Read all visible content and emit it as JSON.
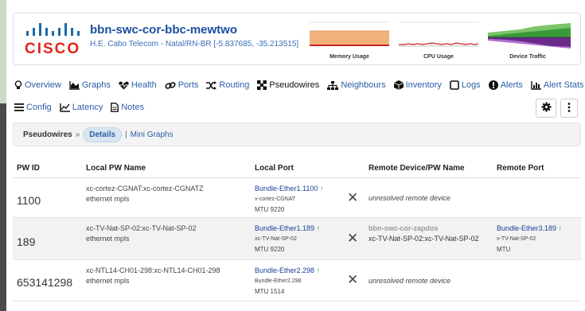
{
  "device": {
    "logo_text": "CISCO",
    "hostname": "bbn-swc-cor-bbc-mewtwo",
    "location": "H.E. Cabo Telecom - Natal/RN-BR [-5.837685, -35.213515]"
  },
  "graphs": [
    {
      "caption": "Memory Usage"
    },
    {
      "caption": "CPU Usage"
    },
    {
      "caption": "Device Traffic"
    }
  ],
  "nav": {
    "row1": [
      {
        "label": "Overview",
        "icon": "lightbulb-icon"
      },
      {
        "label": "Graphs",
        "icon": "area-chart-icon"
      },
      {
        "label": "Health",
        "icon": "heartbeat-icon"
      },
      {
        "label": "Ports",
        "icon": "link-icon"
      },
      {
        "label": "Routing",
        "icon": "random-icon"
      },
      {
        "label": "Pseudowires",
        "icon": "pseudowire-icon"
      },
      {
        "label": "Neighbours",
        "icon": "sitemap-icon"
      },
      {
        "label": "Inventory",
        "icon": "cube-icon"
      },
      {
        "label": "Logs",
        "icon": "logs-icon"
      },
      {
        "label": "Alerts",
        "icon": "exclamation-icon"
      },
      {
        "label": "Alert Stats",
        "icon": "bar-chart-icon"
      }
    ],
    "row2": [
      {
        "label": "Config",
        "icon": "align-justify-icon"
      },
      {
        "label": "Latency",
        "icon": "line-chart-icon"
      },
      {
        "label": "Notes",
        "icon": "file-icon"
      }
    ],
    "active": "Pseudowires"
  },
  "breadcrumb": {
    "section": "Pseudowires",
    "separator": "»",
    "active": "Details",
    "divider": "|",
    "other": "Mini Graphs"
  },
  "table": {
    "headers": [
      "PW ID",
      "Local PW Name",
      "Local Port",
      "Remote Device/PW Name",
      "Remote Port"
    ],
    "rows": [
      {
        "pw_id": "1100",
        "pw_name": "xc-cortez-CGNAT:xc-cortez-CGNATZ",
        "pw_type": "ethernet mpls",
        "local_port": "Bundle-Ether1.1100",
        "local_desc": "v-cortez-CGNAT",
        "local_mtu": "MTU 9220",
        "remote_device": "",
        "remote_text": "unresolved remote device",
        "remote_port": "",
        "remote_desc": "",
        "remote_mtu": ""
      },
      {
        "pw_id": "189",
        "pw_name": "xc-TV-Nat-SP-02:xc-TV-Nat-SP-02",
        "pw_type": "ethernet mpls",
        "local_port": "Bundle-Ether1.189",
        "local_desc": "xc-TV-Nat-SP-02",
        "local_mtu": "MTU 9220",
        "remote_device": "bbn-swc-cor-zapdos",
        "remote_text": "xc-TV-Nat-SP-02:xc-TV-Nat-SP-02",
        "remote_port": "Bundle-Ether3.189",
        "remote_desc": "v-TV-Nat-SP-02",
        "remote_mtu": "MTU"
      },
      {
        "pw_id": "653141298",
        "pw_name": "xc-NTL14-CH01-298:xc-NTL14-CH01-298",
        "pw_type": "ethernet mpls",
        "local_port": "Bundle-Ether2.298",
        "local_desc": "Bundle-Ether2.298",
        "local_mtu": "MTU 1514",
        "remote_device": "",
        "remote_text": "unresolved remote device",
        "remote_port": "",
        "remote_desc": "",
        "remote_mtu": ""
      }
    ]
  },
  "colors": {
    "brand": "#e2231a",
    "link": "#2b5ea7",
    "status_up": "#2aa832",
    "memory_fill": "#f0b27a",
    "cpu_line": "#cc2222"
  }
}
